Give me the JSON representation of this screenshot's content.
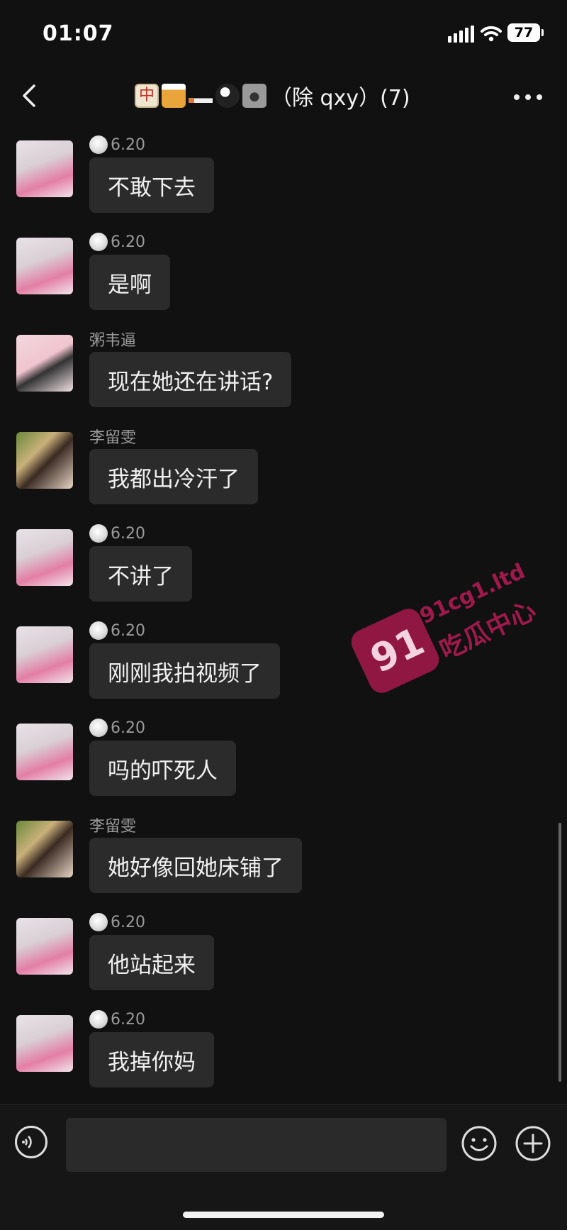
{
  "status_bar": {
    "time": "01:07",
    "battery": "77"
  },
  "header": {
    "title": "（除 qxy）(7)"
  },
  "messages": [
    {
      "sender": "6.20",
      "badge": true,
      "text": "不敢下去",
      "avatar": "a"
    },
    {
      "sender": "6.20",
      "badge": true,
      "text": "是啊",
      "avatar": "a"
    },
    {
      "sender": "粥韦逼",
      "badge": false,
      "text": "现在她还在讲话?",
      "avatar": "b"
    },
    {
      "sender": "李留雯",
      "badge": false,
      "text": "我都出冷汗了",
      "avatar": "c"
    },
    {
      "sender": "6.20",
      "badge": true,
      "text": "不讲了",
      "avatar": "a"
    },
    {
      "sender": "6.20",
      "badge": true,
      "text": "刚刚我拍视频了",
      "avatar": "a"
    },
    {
      "sender": "6.20",
      "badge": true,
      "text": "吗的吓死人",
      "avatar": "a"
    },
    {
      "sender": "李留雯",
      "badge": false,
      "text": "她好像回她床铺了",
      "avatar": "c"
    },
    {
      "sender": "6.20",
      "badge": true,
      "text": "他站起来",
      "avatar": "a"
    },
    {
      "sender": "6.20",
      "badge": true,
      "text": "我掉你妈",
      "avatar": "a"
    }
  ],
  "input": {
    "value": "",
    "placeholder": ""
  },
  "watermark": {
    "number": "91",
    "url": "91cg1.ltd",
    "name": "吃瓜中心"
  }
}
